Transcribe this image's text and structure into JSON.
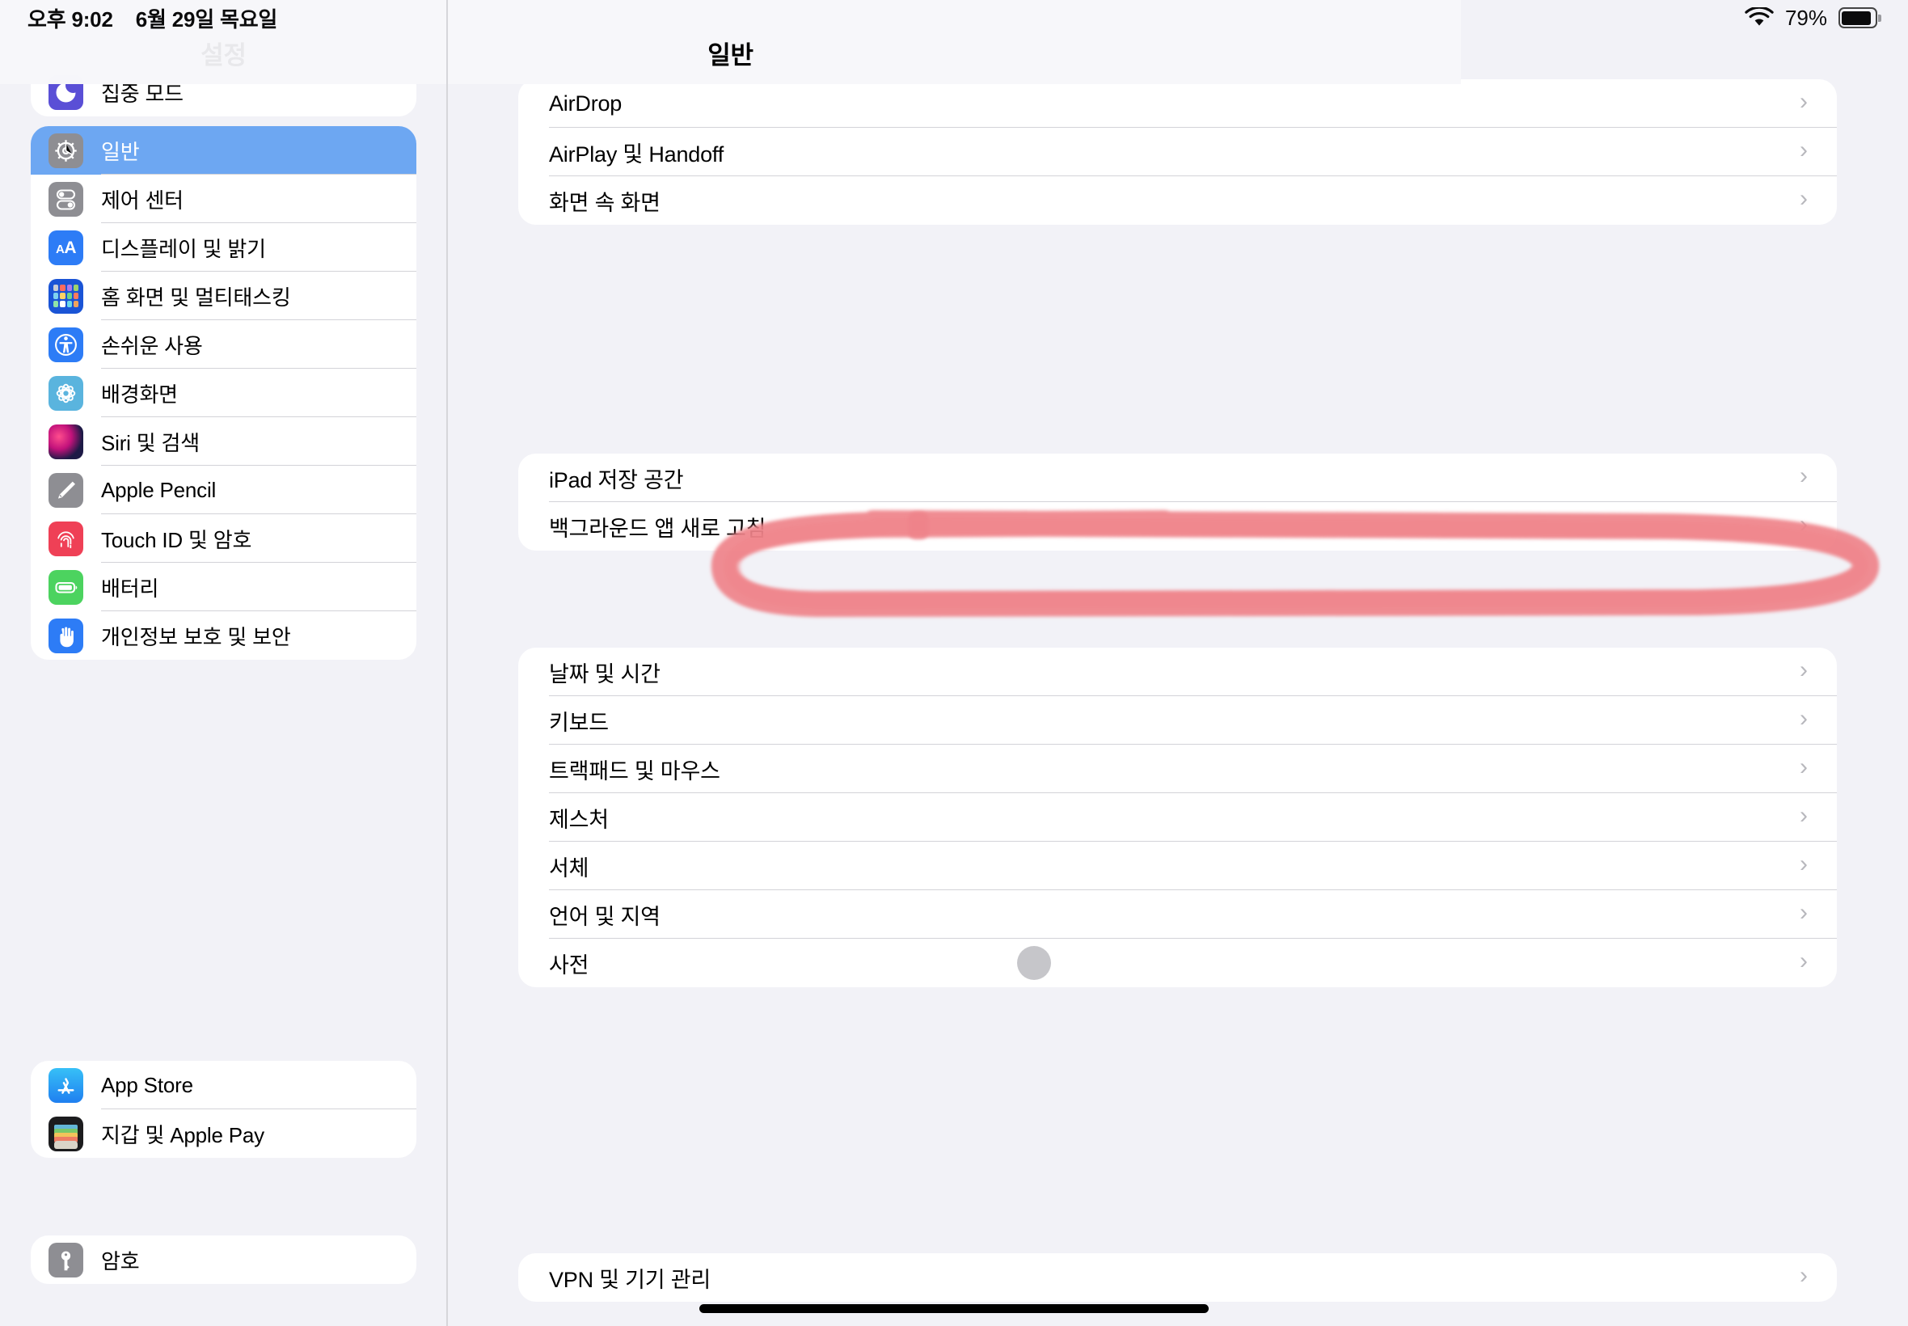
{
  "status_bar": {
    "time": "오후 9:02",
    "date": "6월 29일 목요일",
    "battery_percent": "79%",
    "wifi_icon": "wifi-icon",
    "battery_icon": "battery-icon"
  },
  "sidebar": {
    "title": "설정",
    "groups": [
      {
        "id": "focus-group",
        "items": [
          {
            "label": "집중 모드",
            "icon": "focus-icon",
            "icon_class": "g-focus",
            "selected": false
          }
        ]
      },
      {
        "id": "system-group",
        "items": [
          {
            "label": "일반",
            "icon": "gear-icon",
            "icon_class": "g-gear",
            "selected": true
          },
          {
            "label": "제어 센터",
            "icon": "control-center-icon",
            "icon_class": "g-cc",
            "selected": false
          },
          {
            "label": "디스플레이 및 밝기",
            "icon": "display-brightness-icon",
            "icon_class": "g-aa",
            "selected": false
          },
          {
            "label": "홈 화면 및 멀티태스킹",
            "icon": "home-screen-icon",
            "icon_class": "g-home",
            "selected": false
          },
          {
            "label": "손쉬운 사용",
            "icon": "accessibility-icon",
            "icon_class": "g-acc",
            "selected": false
          },
          {
            "label": "배경화면",
            "icon": "wallpaper-icon",
            "icon_class": "g-wall",
            "selected": false
          },
          {
            "label": "Siri 및 검색",
            "icon": "siri-icon",
            "icon_class": "g-siri",
            "selected": false
          },
          {
            "label": "Apple Pencil",
            "icon": "apple-pencil-icon",
            "icon_class": "g-pencil",
            "selected": false
          },
          {
            "label": "Touch ID 및 암호",
            "icon": "touch-id-icon",
            "icon_class": "g-touch",
            "selected": false
          },
          {
            "label": "배터리",
            "icon": "battery-settings-icon",
            "icon_class": "g-batt",
            "selected": false
          },
          {
            "label": "개인정보 보호 및 보안",
            "icon": "privacy-hand-icon",
            "icon_class": "g-priv",
            "selected": false
          }
        ]
      },
      {
        "id": "store-group",
        "items": [
          {
            "label": "App Store",
            "icon": "app-store-icon",
            "icon_class": "g-appstore",
            "selected": false
          },
          {
            "label": "지갑 및 Apple Pay",
            "icon": "wallet-icon",
            "icon_class": "g-wallet",
            "selected": false
          }
        ]
      },
      {
        "id": "passwords-group",
        "items": [
          {
            "label": "암호",
            "icon": "key-icon",
            "icon_class": "g-key",
            "selected": false
          }
        ]
      }
    ]
  },
  "detail": {
    "title": "일반",
    "chevron": "›",
    "groups": [
      {
        "id": "sharing-group",
        "items": [
          {
            "label": "AirDrop"
          },
          {
            "label": "AirPlay 및 Handoff"
          },
          {
            "label": "화면 속 화면"
          }
        ]
      },
      {
        "id": "storage-group",
        "items": [
          {
            "label": "iPad 저장 공간"
          },
          {
            "label": "백그라운드 앱 새로 고침"
          }
        ]
      },
      {
        "id": "input-group",
        "items": [
          {
            "label": "날짜 및 시간"
          },
          {
            "label": "키보드"
          },
          {
            "label": "트랙패드 및 마우스",
            "annotated": true
          },
          {
            "label": "제스처"
          },
          {
            "label": "서체"
          },
          {
            "label": "언어 및 지역"
          },
          {
            "label": "사전"
          }
        ]
      },
      {
        "id": "vpn-group",
        "items": [
          {
            "label": "VPN 및 기기 관리"
          }
        ]
      }
    ]
  },
  "annotation": {
    "type": "hand-drawn-ellipse",
    "target_label": "트랙패드 및 마우스",
    "color": "#ef8289"
  },
  "cursor": {
    "type": "pointer-blob",
    "color": "#78788066"
  },
  "colors": {
    "selection_blue": "#6da7f2",
    "page_background": "#f2f2f7",
    "card_background": "#ffffff",
    "separator": "#d3d3d8",
    "annotation_red": "#ef8289"
  }
}
